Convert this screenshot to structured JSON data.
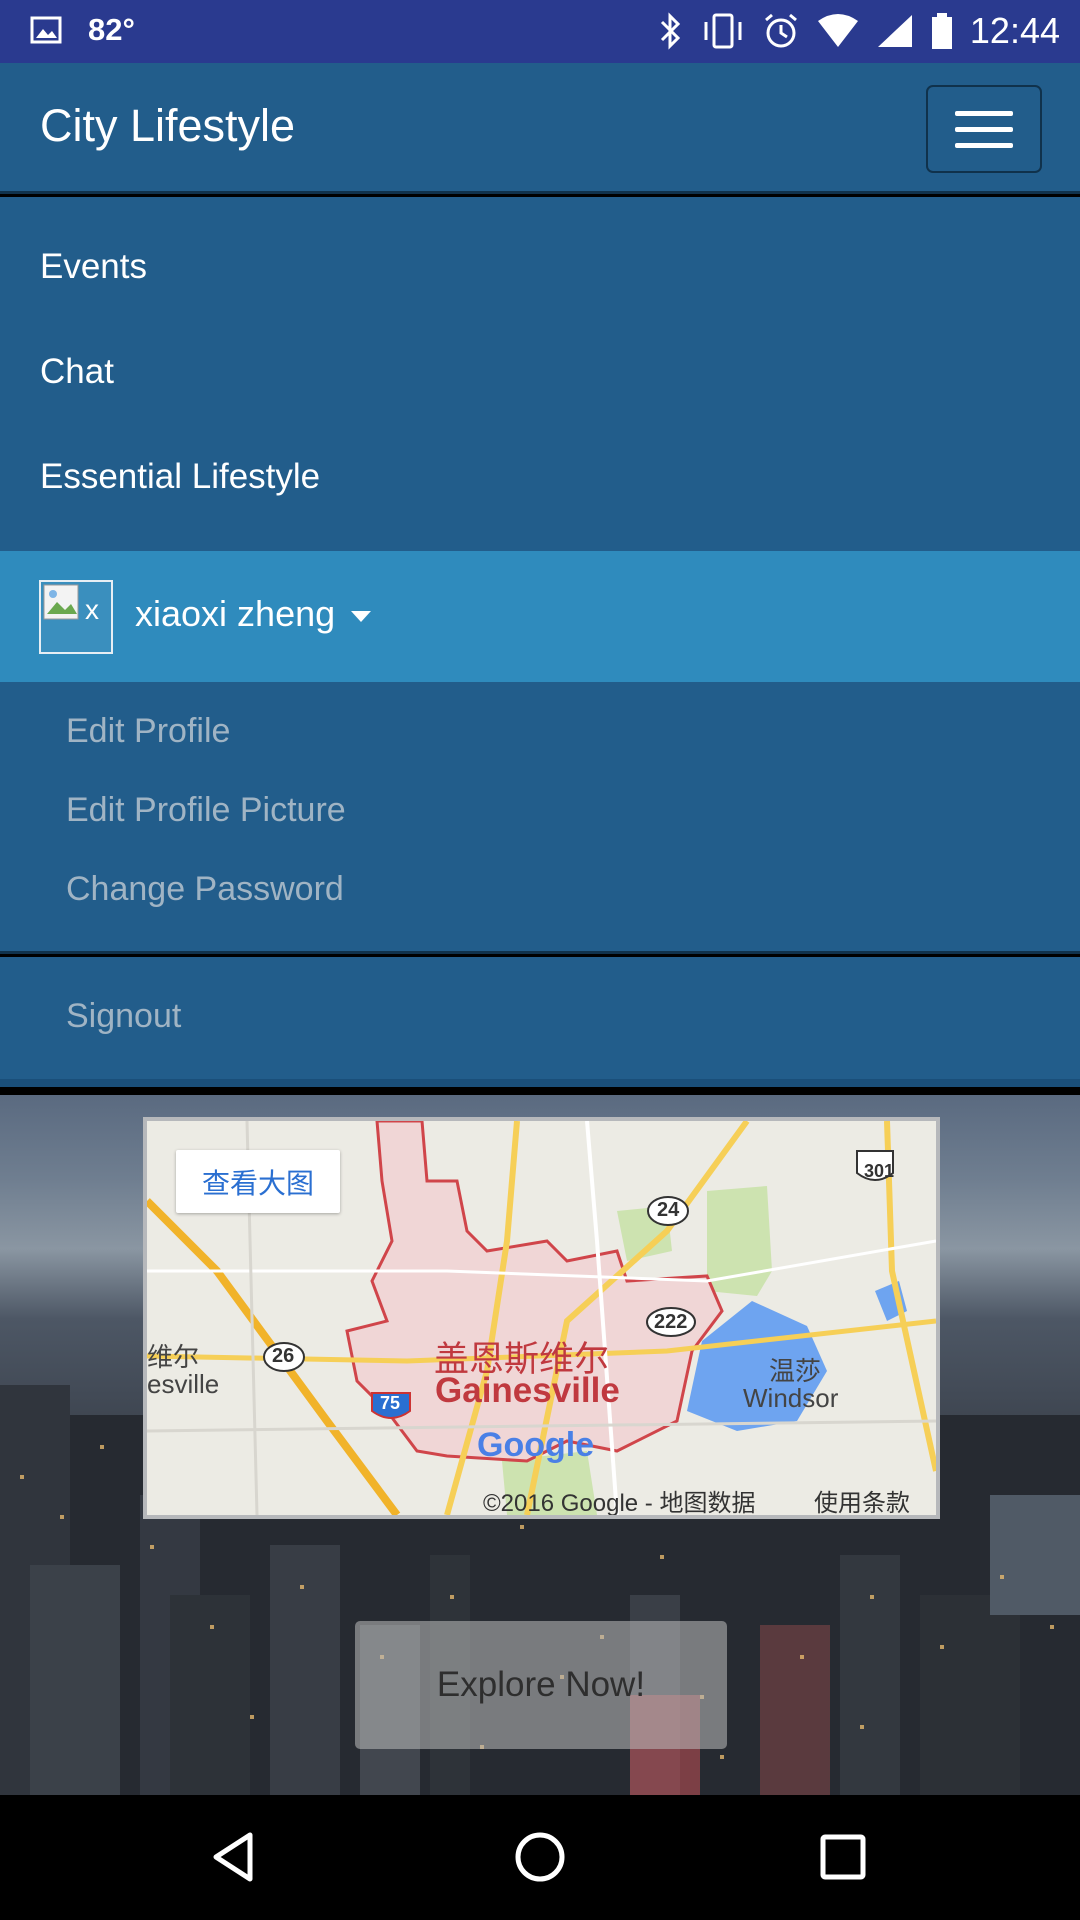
{
  "status_bar": {
    "temperature": "82°",
    "time": "12:44"
  },
  "header": {
    "brand": "City Lifestyle",
    "menu_toggle_icon": "hamburger-icon"
  },
  "menu": {
    "items": [
      "Events",
      "Chat",
      "Essential Lifestyle"
    ]
  },
  "user": {
    "name": "xiaoxi zheng",
    "avatar_alt": "x"
  },
  "user_menu": {
    "items": [
      "Edit Profile",
      "Edit Profile Picture",
      "Change Password"
    ],
    "signout": "Signout"
  },
  "map": {
    "view_larger": "查看大图",
    "city_cn": "盖恩斯维尔",
    "city_en": "Gainesville",
    "left_label_cn": "维尔",
    "left_label_en": "esville",
    "windsor_cn": "温莎",
    "windsor_en": "Windsor",
    "google": "Google",
    "credit": "©2016 Google - 地图数据",
    "terms": "使用条款",
    "shields": [
      "301",
      "24",
      "222",
      "26",
      "75"
    ]
  },
  "cta": {
    "label": "Explore Now!"
  }
}
